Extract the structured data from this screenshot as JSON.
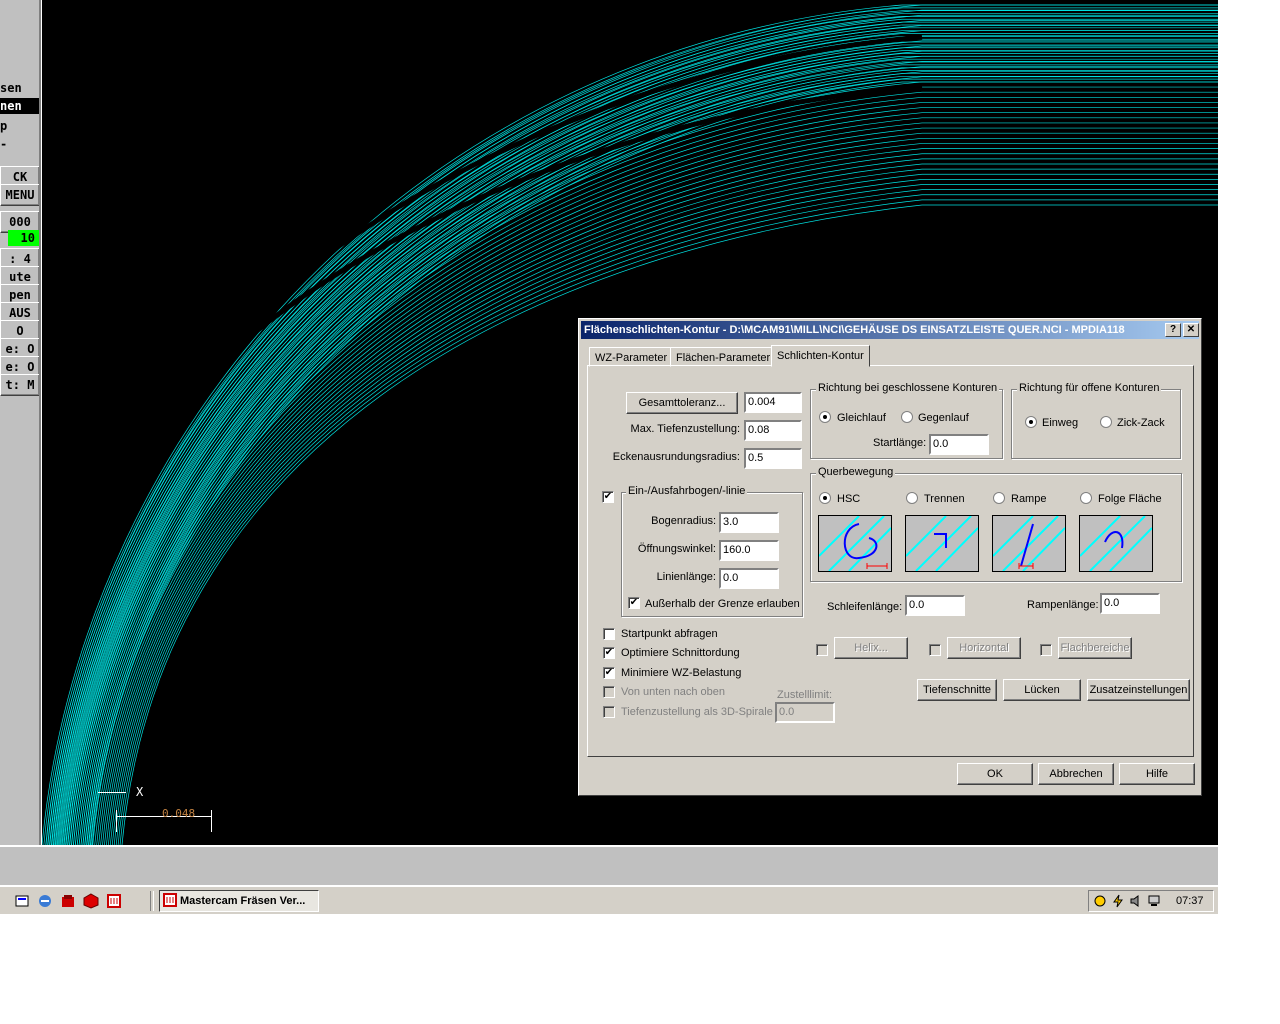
{
  "leftmenu": {
    "items": [
      {
        "label": "sen",
        "style": "plain"
      },
      {
        "label": "nen",
        "style": "sel"
      },
      {
        "label": "p",
        "style": "plain"
      },
      {
        "label": "-",
        "style": "plain"
      },
      {
        "label": "CK",
        "style": "btn"
      },
      {
        "label": "MENU",
        "style": "btn"
      },
      {
        "label": "000",
        "style": "btn"
      },
      {
        "label": "10",
        "style": "green"
      },
      {
        "label": ": 4",
        "style": "btn"
      },
      {
        "label": "ute",
        "style": "btn"
      },
      {
        "label": "pen",
        "style": "btn"
      },
      {
        "label": "AUS",
        "style": "btn"
      },
      {
        "label": "O",
        "style": "btn"
      },
      {
        "label": "e: O",
        "style": "btn"
      },
      {
        "label": "e: O",
        "style": "btn"
      },
      {
        "label": "t: M",
        "style": "btn"
      }
    ]
  },
  "viewport": {
    "axis_label": "X",
    "scale_value": "0.048"
  },
  "dialog": {
    "title": "Flächenschlichten-Kontur - D:\\MCAM91\\MILL\\NCI\\GEHÄUSE DS EINSATZLEISTE QUER.NCI - MPDIA118",
    "help_btn": "?",
    "close_btn": "✕",
    "tabs": [
      "WZ-Parameter",
      "Flächen-Parameter",
      "Schlichten-Kontur"
    ],
    "tolerance_button": "Gesamttoleranz...",
    "tolerance_value": "0.004",
    "max_depth_label": "Max. Tiefenzustellung:",
    "max_depth_value": "0.08",
    "corner_radius_label": "Eckenausrundungsradius:",
    "corner_radius_value": "0.5",
    "closed_group": {
      "title": "Richtung bei geschlossene Konturen",
      "opt1": "Gleichlauf",
      "opt2": "Gegenlauf",
      "start_label": "Startlänge:",
      "start_value": "0.0"
    },
    "open_group": {
      "title": "Richtung für offene Konturen",
      "opt1": "Einweg",
      "opt2": "Zick-Zack"
    },
    "cross_group": {
      "title": "Querbewegung",
      "opt1": "HSC",
      "opt2": "Trennen",
      "opt3": "Rampe",
      "opt4": "Folge Fläche"
    },
    "arc_group": {
      "title": "Ein-/Ausfahrbogen/-linie",
      "radius_label": "Bogenradius:",
      "radius_value": "3.0",
      "angle_label": "Öffnungswinkel:",
      "angle_value": "160.0",
      "line_label": "Linienlänge:",
      "line_value": "0.0",
      "outside_label": "Außerhalb der Grenze erlauben"
    },
    "loop_label": "Schleifenlänge:",
    "loop_value": "0.0",
    "ramp_label": "Rampenlänge:",
    "ramp_value": "0.0",
    "checks": {
      "startpoint": "Startpunkt abfragen",
      "optimize": "Optimiere Schnittordung",
      "minimize": "Minimiere WZ-Belastung",
      "bottom_up": "Von unten nach oben",
      "spiral": "Tiefenzustellung als 3D-Spirale"
    },
    "feed_limit_label": "Zustelllimit:",
    "feed_limit_value": "0.0",
    "helix_btn": "Helix...",
    "horizontal_btn": "Horizontal",
    "flat_btn": "Flachbereiche",
    "depth_btn": "Tiefenschnitte",
    "gaps_btn": "Lücken",
    "extra_btn": "Zusatzeinstellungen",
    "ok_btn": "OK",
    "cancel_btn": "Abbrechen",
    "help_btn2": "Hilfe"
  },
  "taskbar": {
    "app_button": "Mastercam Fräsen Ver...",
    "clock": "07:37"
  }
}
